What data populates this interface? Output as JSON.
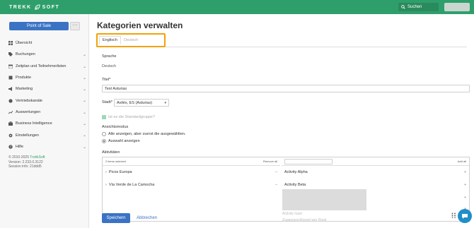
{
  "header": {
    "logo_left": "TREKK",
    "logo_right": "SOFT",
    "search_label": "Suchen"
  },
  "sidebar": {
    "pos_button": "Point of Sale",
    "more_button": "···",
    "items": [
      {
        "label": "Übersicht",
        "icon": "grid-icon",
        "chevron": false
      },
      {
        "label": "Buchungen",
        "icon": "tag-icon",
        "chevron": true
      },
      {
        "label": "Zeitplan und Teilnehmerlisten",
        "icon": "calendar-icon",
        "chevron": true
      },
      {
        "label": "Produkte",
        "icon": "box-icon",
        "chevron": true
      },
      {
        "label": "Marketing",
        "icon": "megaphone-icon",
        "chevron": true
      },
      {
        "label": "Vertriebskanäle",
        "icon": "globe-icon",
        "chevron": true
      },
      {
        "label": "Auswertungen",
        "icon": "chart-icon",
        "chevron": true
      },
      {
        "label": "Business Intelligence",
        "icon": "briefcase-icon",
        "chevron": true
      },
      {
        "label": "Einstellungen",
        "icon": "gear-icon",
        "chevron": true
      },
      {
        "label": "Hilfe",
        "icon": "help-icon",
        "chevron": true
      }
    ],
    "footer": {
      "copyright_prefix": "© 2010-2025 ",
      "copyright_brand": "TrekkSoft",
      "version": "Version: 2.233.0.3122",
      "session": "Session info: 21ddd5"
    }
  },
  "main": {
    "title": "Kategorien verwalten",
    "tabs": [
      {
        "label": "Englisch",
        "active": true
      },
      {
        "label": "Deutsch",
        "active": false
      }
    ],
    "sprache_label": "Sprache",
    "sprache_value": "Deutsch",
    "titel_label": "Titel*",
    "titel_value": "Test Asturias",
    "stadt_label": "Stadt*",
    "stadt_value": "Avilés, ES (Asturias)",
    "stadt_arrow": "▾",
    "default_group_label": "Ist es die Standardgruppe?",
    "ansicht_label": "Ansichtsmodus",
    "ansicht_options": [
      {
        "label": "Alle anzeigen, aber zuerst die ausgewählten.",
        "selected": false
      },
      {
        "label": "Auswahl anzeigen",
        "selected": true
      }
    ],
    "aktivitaeten_label": "Aktivitäten",
    "left_header": "2 items selected",
    "left_action": "Remove all",
    "left_items": [
      {
        "label": "Picos Europa",
        "op": "–"
      },
      {
        "label": "Vía Verde de La Camocha",
        "op": "–"
      }
    ],
    "right_action": "Add all",
    "right_items": [
      {
        "label": "Activity Alpha",
        "op": "+"
      },
      {
        "label": "Activity Beta",
        "op": "+"
      }
    ],
    "right_extra_ops": [
      "+",
      "+",
      "+"
    ],
    "faded_items": [
      "Activity Gam",
      "Zugangsschlüssel wer Rosé"
    ],
    "save_button": "Speichern",
    "cancel_link": "Abbrechen"
  },
  "colors": {
    "brand_green": "#2e9f6b",
    "primary_blue": "#3b73c4",
    "highlight_orange": "#f0a20a",
    "chat_blue": "#1f8ec9"
  }
}
